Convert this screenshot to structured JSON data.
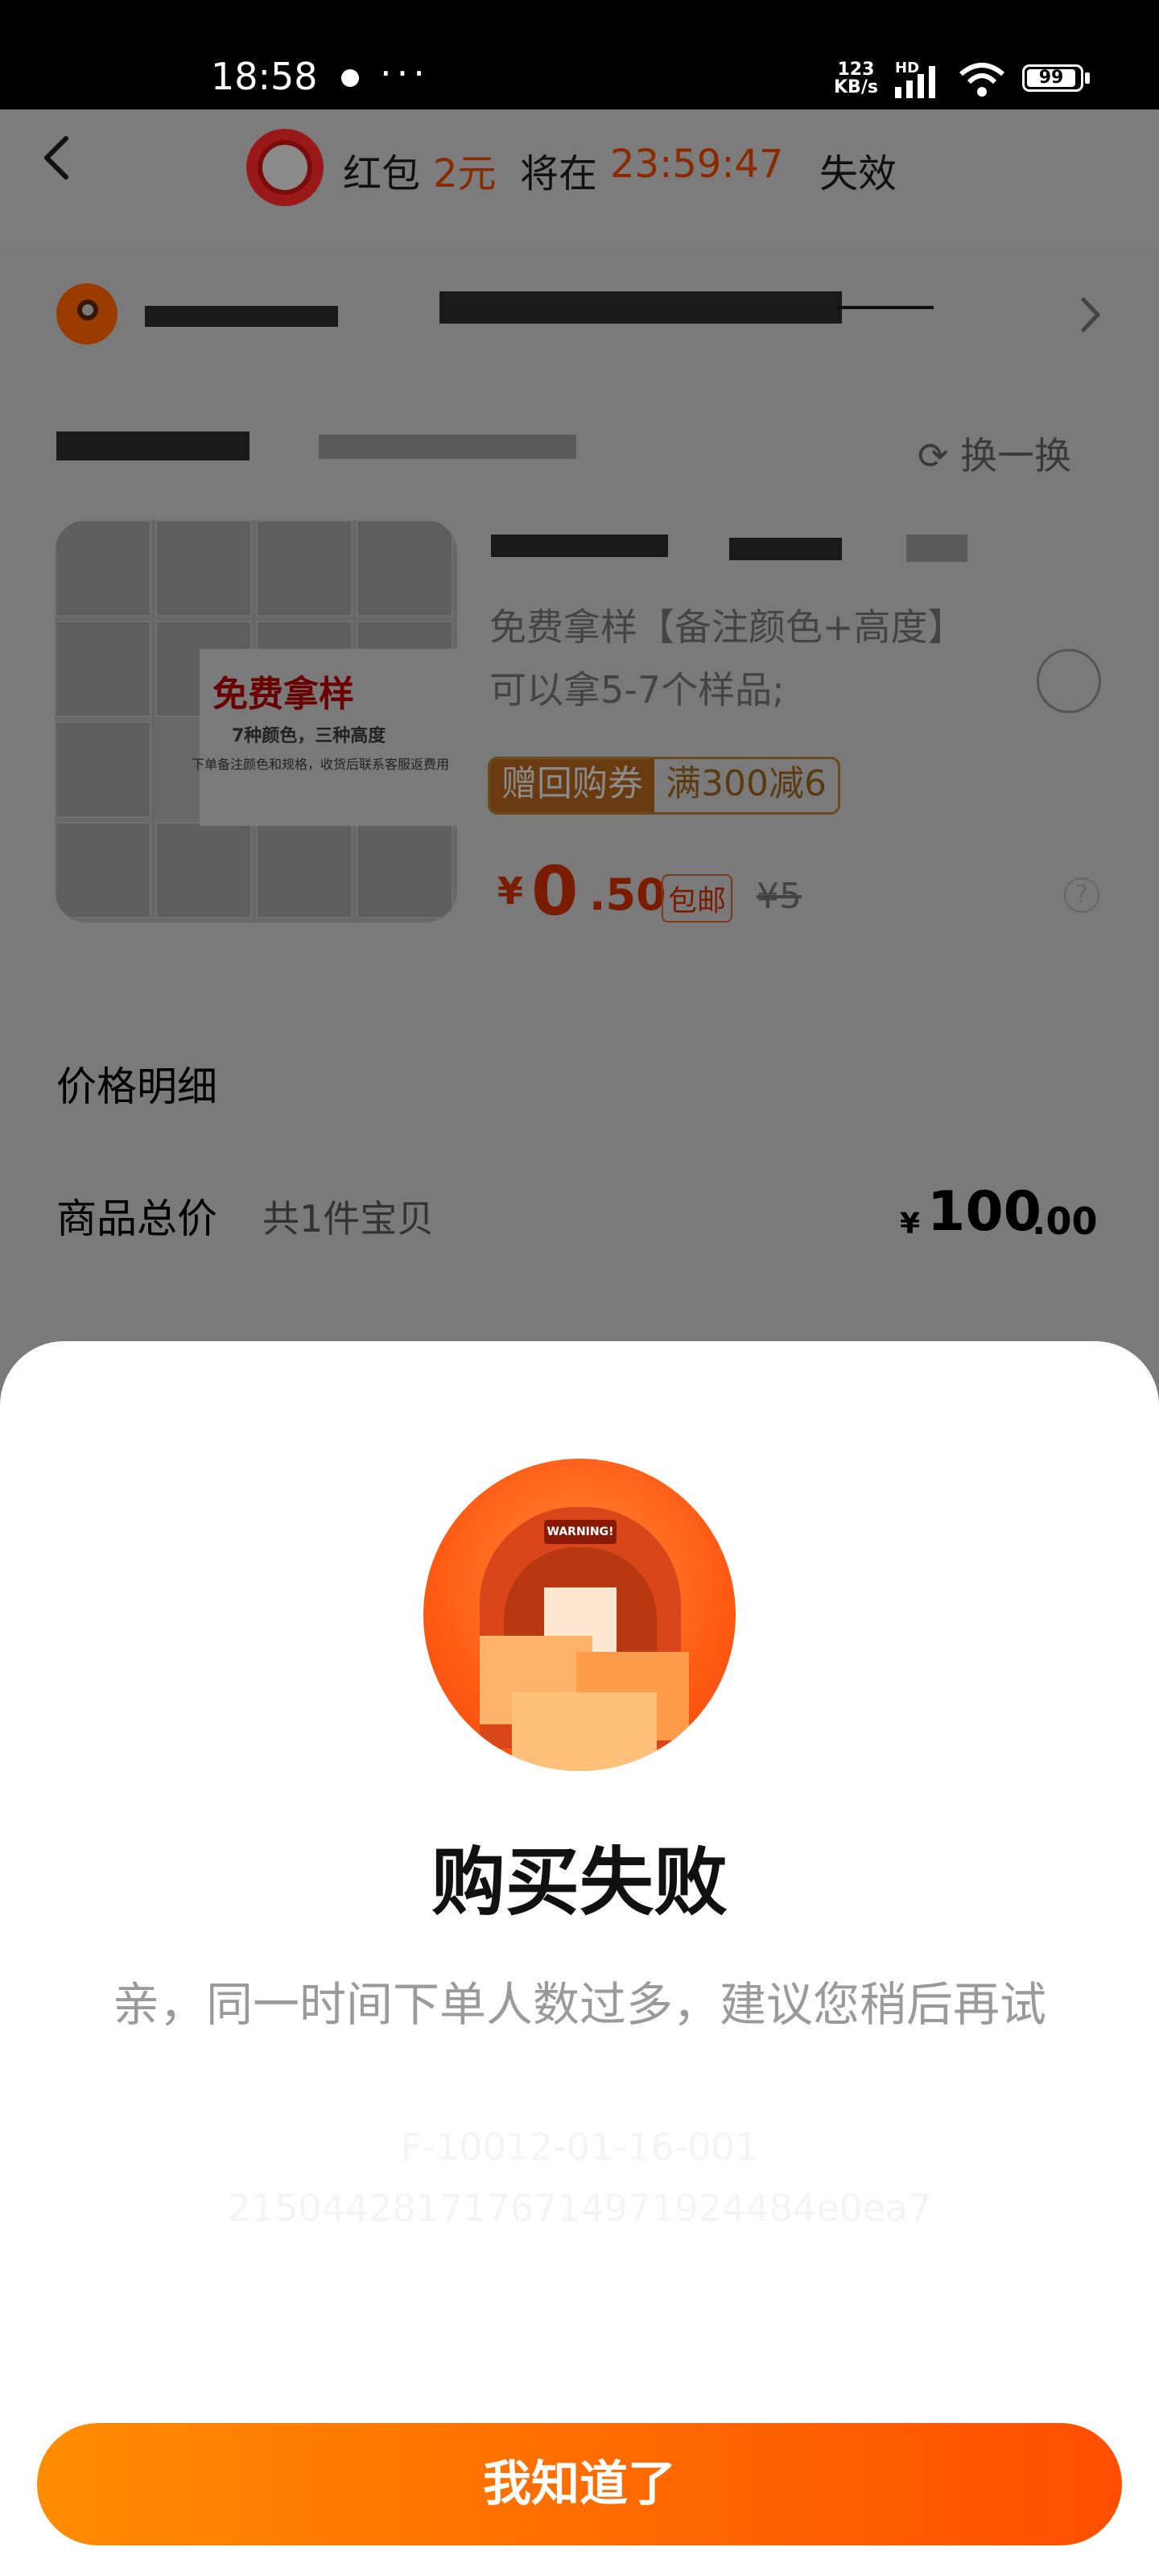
{
  "status_bar": {
    "time": "18:58",
    "more": "···",
    "net_speed_value": "123",
    "net_speed_unit": "KB/s",
    "hd": "HD",
    "battery": "99"
  },
  "header": {
    "label_prefix": "红包",
    "amount": "2元",
    "label_mid": "将在",
    "countdown": "23:59:47",
    "label_suffix": "失效"
  },
  "product": {
    "swap_label": "⟳ 换一换",
    "image_title": "免费拿样",
    "image_subtitle": "7种颜色，三种高度",
    "image_note": "下单备注颜色和规格，收货后联系客服返费用",
    "description": "免费拿样【备注颜色+高度】可以拿5-7个样品;",
    "coupon_tag": "赠回购券",
    "coupon_value": "满300减6",
    "price_symbol": "¥",
    "price_int": "0",
    "price_dec": ".50",
    "shipping": "包邮",
    "original_price": "¥5"
  },
  "details": {
    "title": "价格明细",
    "row_label": "商品总价",
    "row_sub": "共1件宝贝",
    "row_symbol": "¥",
    "row_int": "100",
    "row_dec": ".00"
  },
  "dialog": {
    "image_sign": "WARNING!",
    "title": "购买失败",
    "message": "亲，同一时间下单人数过多，建议您稍后再试",
    "error_code": "F-10012-01-16-001",
    "trace_id": "2150442817176714971924484e0ea7",
    "button": "我知道了"
  }
}
